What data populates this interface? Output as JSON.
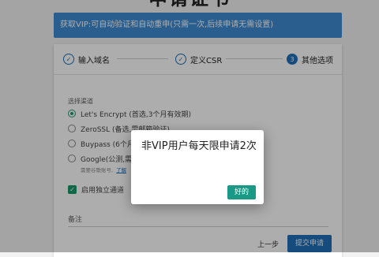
{
  "page": {
    "title": "申请证书"
  },
  "banner": {
    "text": "获取VIP:可自动验证和自动重申(只需一次,后续申请无需设置)"
  },
  "stepper": {
    "steps": [
      {
        "label": "输入域名",
        "state": "done",
        "icon": "check-icon"
      },
      {
        "label": "定义CSR",
        "state": "done",
        "icon": "check-icon"
      },
      {
        "label": "其他选项",
        "state": "active",
        "number": "3"
      }
    ]
  },
  "form": {
    "channel_label": "选择渠道",
    "channels": [
      {
        "label": "Let's Encrypt (首选,3个月有效期)",
        "checked": true
      },
      {
        "label": "ZeroSSL (备选,需邮箱验证)",
        "checked": false
      },
      {
        "label": "Buypass (6个月",
        "checked": false
      },
      {
        "label": "Google(公测,需",
        "checked": false
      }
    ],
    "hint_text": "需要谷歌账号,",
    "hint_link": "了解",
    "independent_channel_label": "启用独立通道",
    "independent_channel_checked": true,
    "note_label": "备注",
    "prev_label": "上一步",
    "submit_label": "提交申请"
  },
  "dialog": {
    "message": "非VIP用户每天限申请2次",
    "ok_label": "好的"
  },
  "colors": {
    "primary": "#1f6fb8",
    "banner": "#3d8bd2",
    "accent_green": "#1a9a6a",
    "ok_button": "#1a9a86"
  }
}
